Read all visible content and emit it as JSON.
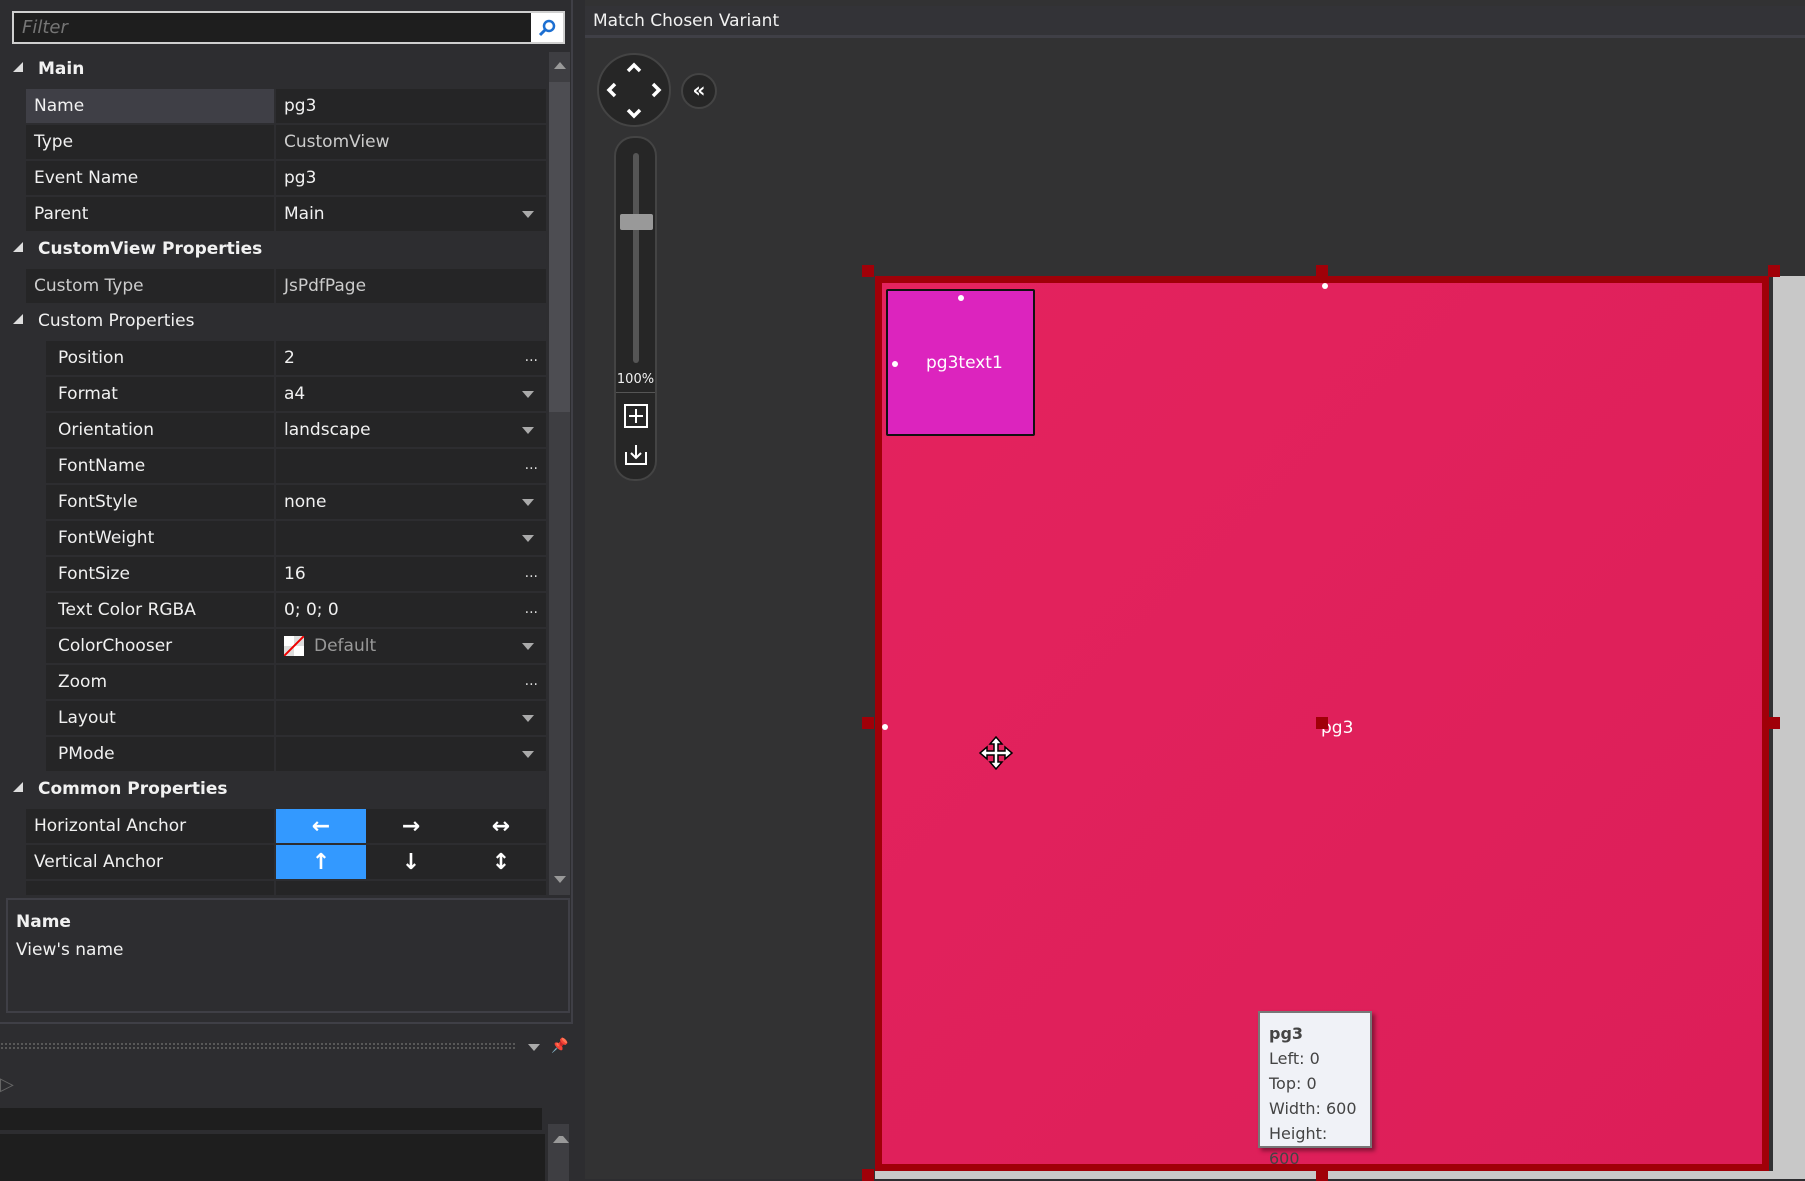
{
  "filter": {
    "placeholder": "Filter",
    "icon": "search-icon"
  },
  "sections": {
    "main": "Main",
    "customview": "CustomView Properties",
    "custom_props": "Custom Properties",
    "common": "Common Properties"
  },
  "props": {
    "name": {
      "label": "Name",
      "value": "pg3"
    },
    "type": {
      "label": "Type",
      "value": "CustomView"
    },
    "event_name": {
      "label": "Event Name",
      "value": "pg3"
    },
    "parent": {
      "label": "Parent",
      "value": "Main"
    },
    "custom_type": {
      "label": "Custom Type",
      "value": "JsPdfPage"
    },
    "position": {
      "label": "Position",
      "value": "2"
    },
    "format": {
      "label": "Format",
      "value": "a4"
    },
    "orientation": {
      "label": "Orientation",
      "value": "landscape"
    },
    "fontname": {
      "label": "FontName",
      "value": ""
    },
    "fontstyle": {
      "label": "FontStyle",
      "value": "none"
    },
    "fontweight": {
      "label": "FontWeight",
      "value": ""
    },
    "fontsize": {
      "label": "FontSize",
      "value": "16"
    },
    "textcolor": {
      "label": "Text Color RGBA",
      "value": "0; 0; 0"
    },
    "colorchooser": {
      "label": "ColorChooser",
      "value": "Default"
    },
    "zoom": {
      "label": "Zoom",
      "value": ""
    },
    "layout": {
      "label": "Layout",
      "value": ""
    },
    "pmode": {
      "label": "PMode",
      "value": ""
    },
    "h_anchor": {
      "label": "Horizontal Anchor",
      "selected": "left"
    },
    "v_anchor": {
      "label": "Vertical Anchor",
      "selected": "top"
    }
  },
  "description": {
    "title": "Name",
    "text": "View's name"
  },
  "designer": {
    "title": "Match Chosen Variant",
    "zoom_label": "100%",
    "zoom_percent": 100,
    "page_label": "pg3",
    "child_label": "pg3text1",
    "tooltip": {
      "name": "pg3",
      "left": "Left: 0",
      "top": "Top: 0",
      "width": "Width: 600",
      "height": "Height: 600"
    }
  },
  "colors": {
    "accent": "#3399ff",
    "page": "#e2225d",
    "page_border": "#a00008",
    "child": "#dc24be"
  }
}
